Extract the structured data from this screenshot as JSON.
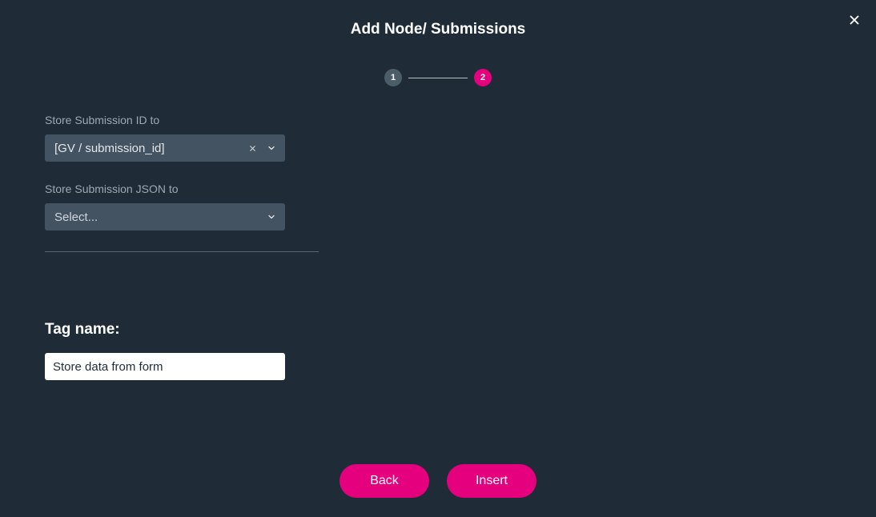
{
  "header": {
    "title": "Add Node/ Submissions"
  },
  "stepper": {
    "step1": "1",
    "step2": "2",
    "active_step": 2
  },
  "fields": {
    "submission_id": {
      "label": "Store Submission ID to",
      "value": "[GV / submission_id]"
    },
    "submission_json": {
      "label": "Store Submission JSON to",
      "placeholder": "Select..."
    }
  },
  "tag": {
    "heading": "Tag name:",
    "value": "Store data from form"
  },
  "footer": {
    "back_label": "Back",
    "insert_label": "Insert"
  },
  "colors": {
    "accent": "#e5007d",
    "panel": "#1f2c38",
    "select_bg": "#445362"
  }
}
